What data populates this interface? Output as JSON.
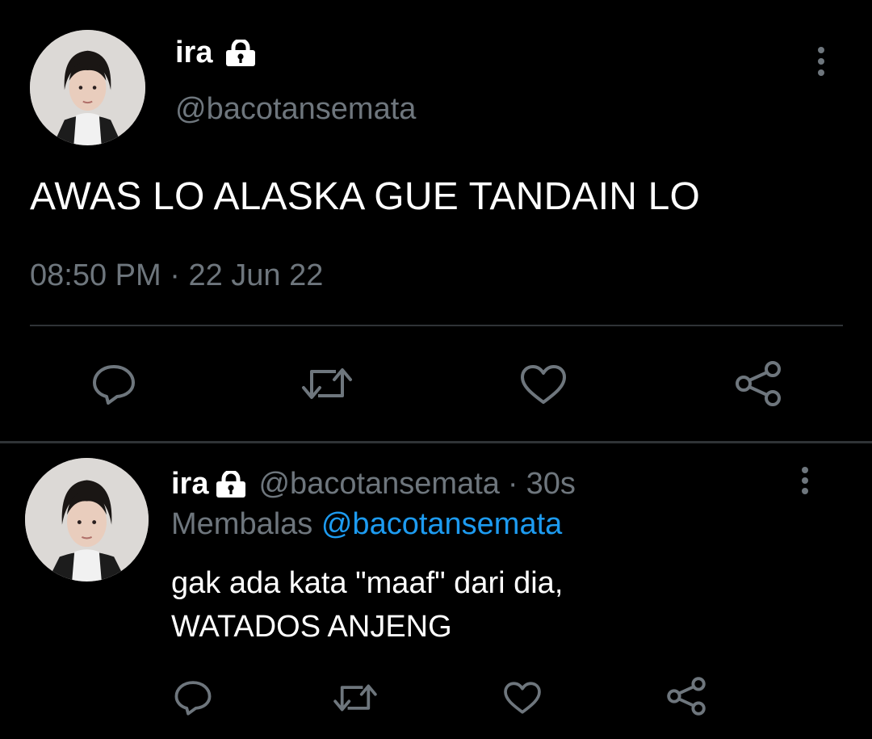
{
  "main_tweet": {
    "name": "ira",
    "handle": "@bacotansemata",
    "text": "AWAS LO ALASKA GUE TANDAIN LO",
    "time": "08:50 PM",
    "separator": "·",
    "date": "22 Jun 22"
  },
  "reply_tweet": {
    "name": "ira",
    "handle": "@bacotansemata",
    "separator": "·",
    "age": "30s",
    "reply_prefix": "Membalas",
    "reply_to": "@bacotansemata",
    "text_line1": "gak ada kata \"maaf\" dari dia,",
    "text_line2": "WATADOS ANJENG"
  },
  "icons": {
    "reply": "comment-bubble-icon",
    "retweet": "retweet-icon",
    "like": "heart-icon",
    "share": "share-icon",
    "lock": "lock-icon",
    "more": "more-vertical-icon"
  },
  "colors": {
    "background": "#000000",
    "text": "#ffffff",
    "muted": "#6e767d",
    "link": "#1d9bf0",
    "divider": "#2f3336"
  }
}
